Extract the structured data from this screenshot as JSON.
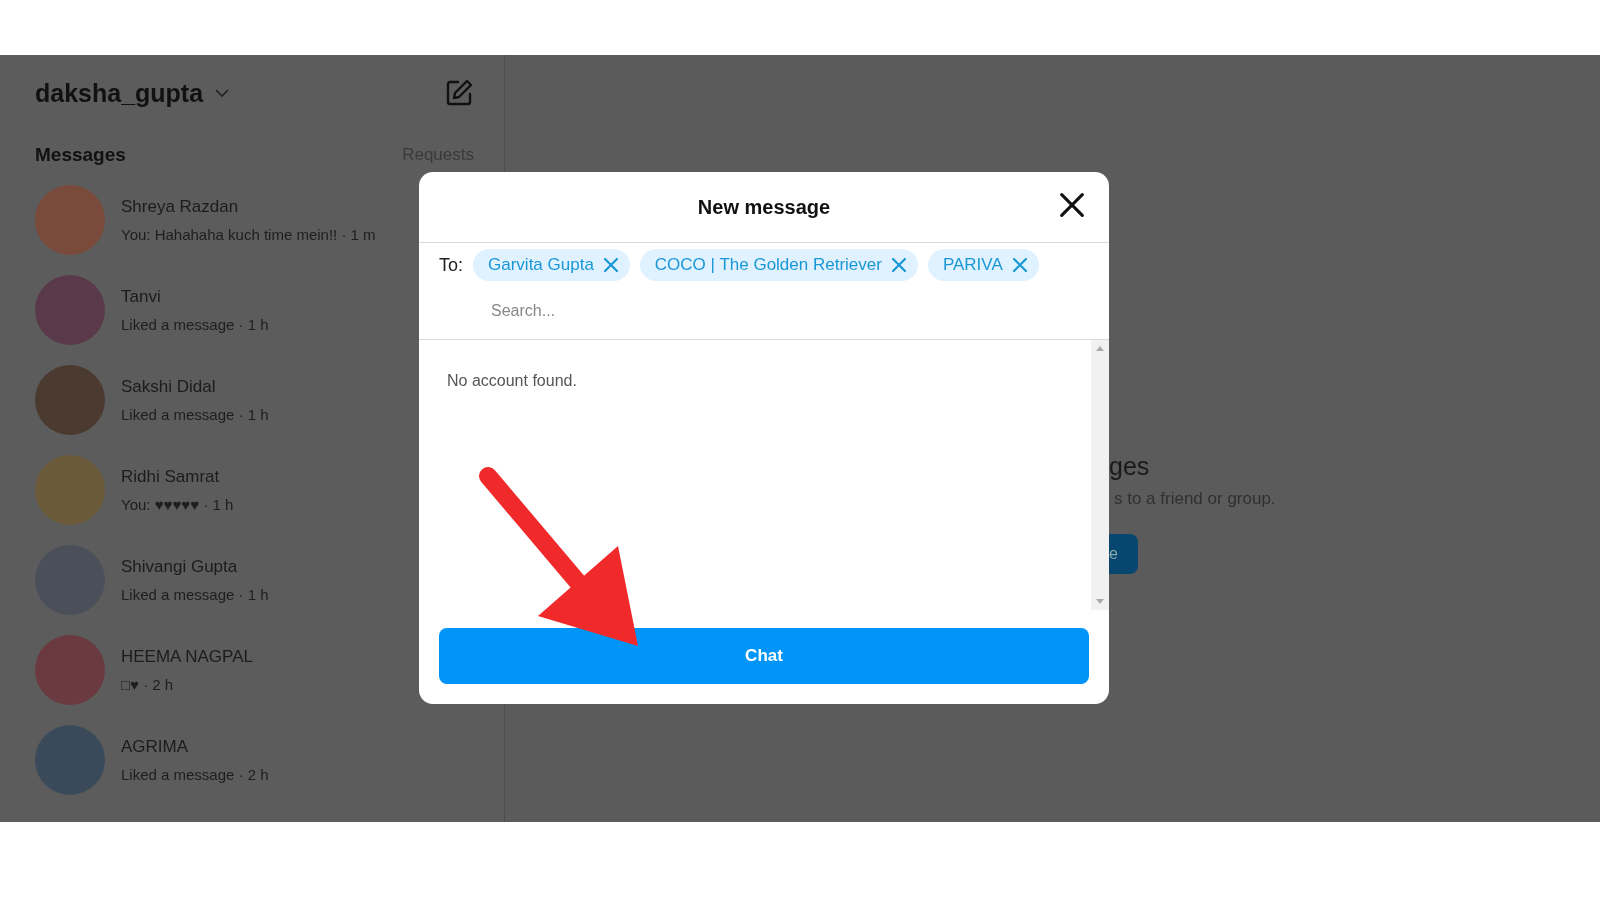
{
  "sidebar": {
    "username": "daksha_gupta",
    "section_title": "Messages",
    "requests_link": "Requests",
    "conversations": [
      {
        "name": "Shreya Razdan",
        "preview": "You: Hahahaha kuch time mein!! · 1 m",
        "color": "#7a4a3a"
      },
      {
        "name": "Tanvi",
        "preview": "Liked a message · 1 h",
        "color": "#5a3a4a"
      },
      {
        "name": "Sakshi Didal",
        "preview": "Liked a message · 1 h",
        "color": "#4a3a30"
      },
      {
        "name": "Ridhi Samrat",
        "preview": "You: ♥♥♥♥♥ · 1 h",
        "color": "#6a5a3a"
      },
      {
        "name": "Shivangi Gupta",
        "preview": "Liked a message · 1 h",
        "color": "#4a4f5a"
      },
      {
        "name": "HEEMA NAGPAL",
        "preview": "□♥ · 2 h",
        "color": "#6a3a40"
      },
      {
        "name": "AGRIMA",
        "preview": "Liked a message · 2 h",
        "color": "#3a4a5a"
      }
    ]
  },
  "main": {
    "heading_fragment": "ges",
    "subtitle_fragment": "s to a friend or group.",
    "button_fragment": "e"
  },
  "dialog": {
    "title": "New message",
    "to_label": "To:",
    "recipients": [
      "Garvita Gupta",
      "COCO | The Golden Retriever",
      "PARIVA"
    ],
    "search": {
      "placeholder": "Search..."
    },
    "empty_message": "No account found.",
    "chat_button": "Chat"
  }
}
